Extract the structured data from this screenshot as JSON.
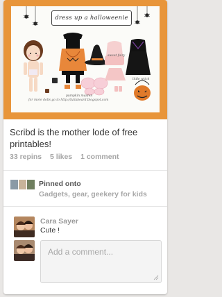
{
  "pin": {
    "image": {
      "title_text": "dress up a halloweenie",
      "captions": {
        "dress": "pumpkin maiden",
        "top": "sweet fairy",
        "witch": "little witch"
      },
      "footer_url": "for more dolls go to http://lullabeard.blogspot.com",
      "border_color": "#e8953a"
    },
    "description": "Scribd is the mother lode of free printables!",
    "stats": {
      "repins": "33 repins",
      "likes": "5 likes",
      "comments": "1 comment"
    }
  },
  "board": {
    "label": "Pinned onto",
    "name": "Gadgets, gear, geekery for kids"
  },
  "comment": {
    "author": "Cara Sayer",
    "text": "Cute !"
  },
  "composer": {
    "placeholder": "Add a comment..."
  }
}
